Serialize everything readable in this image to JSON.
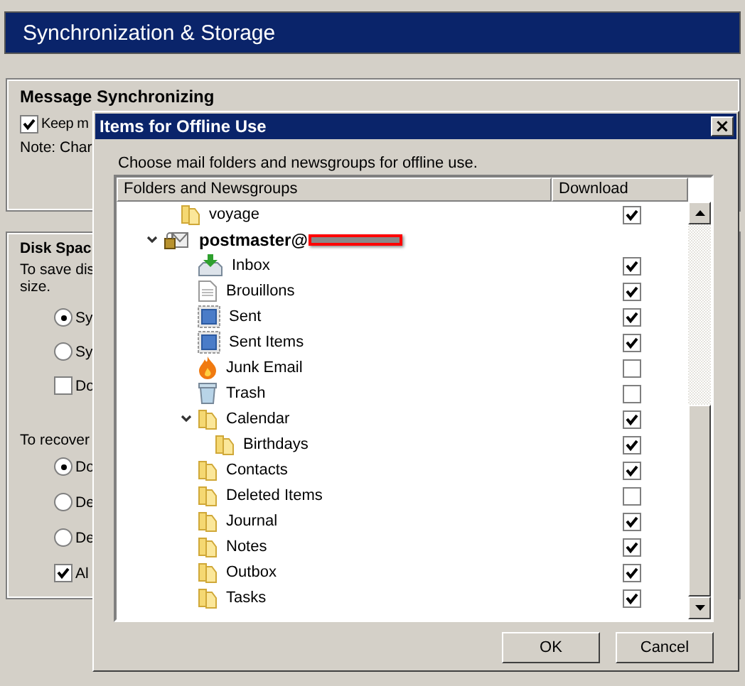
{
  "page": {
    "title": "Synchronization & Storage",
    "message_group": {
      "title": "Message Synchronizing",
      "checkbox": {
        "label": "Keep m",
        "checked": true
      },
      "note": "Note: Char"
    },
    "disk_group": {
      "title": "Disk Spac",
      "text_1": "To save dis",
      "text_2": "size.",
      "options_1": [
        {
          "kind": "radio",
          "label": "Sy",
          "selected": true
        },
        {
          "kind": "radio",
          "label": "Sy",
          "selected": false
        },
        {
          "kind": "checkbox",
          "label": "Do",
          "checked": false
        }
      ],
      "text_3": "To recover",
      "options_2": [
        {
          "kind": "radio",
          "label": "Do",
          "selected": true
        },
        {
          "kind": "radio",
          "label": "De",
          "selected": false
        },
        {
          "kind": "radio",
          "label": "De",
          "selected": false
        },
        {
          "kind": "checkbox",
          "label": "Al",
          "checked": true
        }
      ]
    }
  },
  "dialog": {
    "title": "Items for Offline Use",
    "close": "×",
    "instruction": "Choose mail folders and newsgroups for offline use.",
    "columns": [
      "Folders and Newsgroups",
      "Download"
    ],
    "tree": [
      {
        "kind": "folder",
        "label": "voyage",
        "checked": true
      },
      {
        "kind": "account",
        "label": "postmaster@",
        "redacted": true,
        "expanded": true,
        "children": [
          {
            "kind": "inbox",
            "label": "Inbox",
            "checked": true
          },
          {
            "kind": "drafts",
            "label": "Brouillons",
            "checked": true
          },
          {
            "kind": "sent",
            "label": "Sent",
            "checked": true
          },
          {
            "kind": "sent",
            "label": "Sent Items",
            "checked": true
          },
          {
            "kind": "junk",
            "label": "Junk Email",
            "checked": false
          },
          {
            "kind": "trash",
            "label": "Trash",
            "checked": false
          },
          {
            "kind": "folder",
            "label": "Calendar",
            "checked": true,
            "expanded": true,
            "children": [
              {
                "kind": "folder",
                "label": "Birthdays",
                "checked": true
              }
            ]
          },
          {
            "kind": "folder",
            "label": "Contacts",
            "checked": true
          },
          {
            "kind": "folder",
            "label": "Deleted Items",
            "checked": false
          },
          {
            "kind": "folder",
            "label": "Journal",
            "checked": true
          },
          {
            "kind": "folder",
            "label": "Notes",
            "checked": true
          },
          {
            "kind": "folder",
            "label": "Outbox",
            "checked": true
          },
          {
            "kind": "folder",
            "label": "Tasks",
            "checked": true
          }
        ]
      }
    ],
    "buttons": [
      "OK",
      "Cancel"
    ]
  }
}
